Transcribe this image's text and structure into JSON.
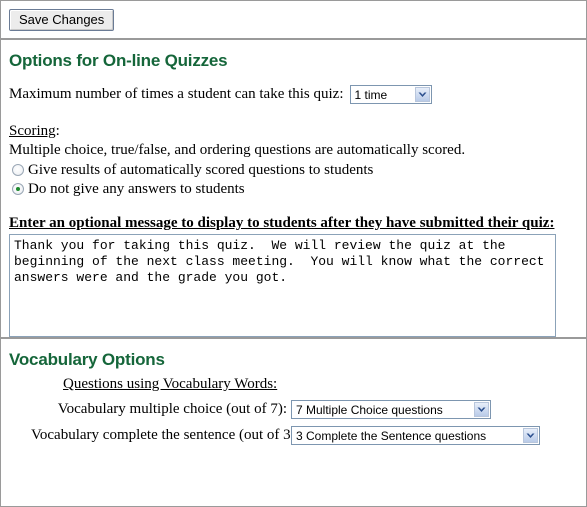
{
  "toolbar": {
    "save_label": "Save Changes"
  },
  "quiz_section": {
    "title": "Options for On-line Quizzes",
    "max_attempts_label": "Maximum number of times a student can take this quiz:",
    "max_attempts_value": "1 time",
    "max_attempts_options": [
      "1 time"
    ],
    "scoring_label": "Scoring",
    "scoring_colon": ":",
    "scoring_note": "Multiple choice, true/false, and ordering questions are automatically scored.",
    "radio_options": [
      {
        "label": "Give results of automatically scored questions to students",
        "selected": false
      },
      {
        "label": "Do not give any answers to students",
        "selected": true
      }
    ],
    "message_heading": "Enter an optional message to display to students after they have submitted their quiz:",
    "message_value": "Thank you for taking this quiz.  We will review the quiz at the beginning of the next class meeting.  You will know what the correct answers were and the grade you got.",
    "message_placeholder": ""
  },
  "vocabulary_section": {
    "title": "Vocabulary Options",
    "subheading": "Questions using Vocabulary Words:",
    "rows": [
      {
        "label": "Vocabulary multiple choice (out of 7):",
        "value": "7 Multiple Choice questions",
        "options": [
          "7 Multiple Choice questions"
        ]
      },
      {
        "label": "Vocabulary complete the sentence (out of 3):",
        "value": "3 Complete the Sentence questions",
        "options": [
          "3 Complete the Sentence questions"
        ]
      }
    ]
  },
  "colors": {
    "heading_green": "#15663a",
    "radio_dot_green": "#1f8a2f",
    "rule_gray": "#9a9a9a",
    "select_border": "#7d96b0"
  }
}
